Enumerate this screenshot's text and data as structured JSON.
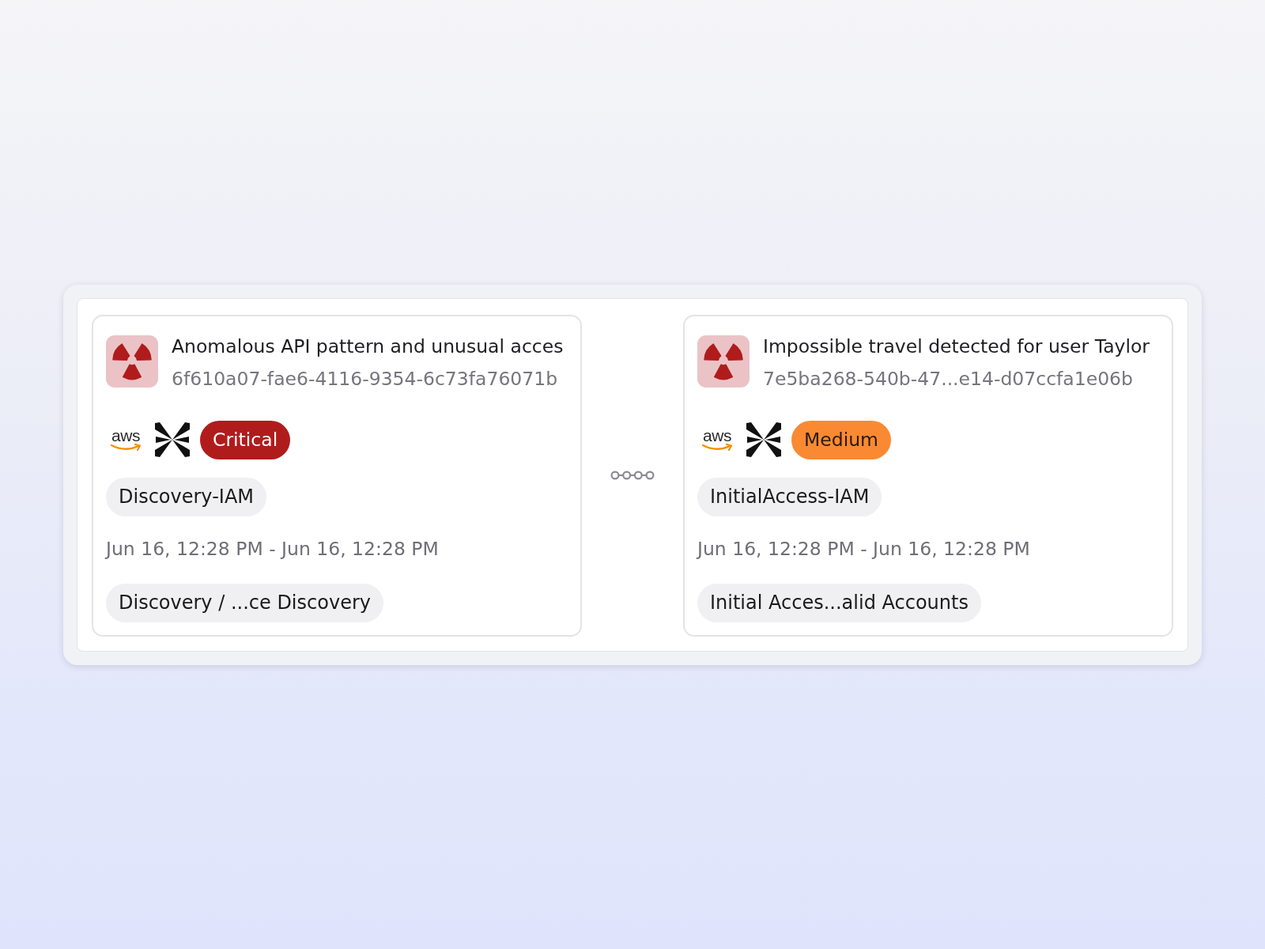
{
  "alerts": [
    {
      "title": "Anomalous API pattern and unusual acces",
      "alert_id": "6f610a07-fae6-4116-9354-6c73fa76071b",
      "provider": "aws",
      "severity": {
        "label": "Critical",
        "color": "#b01c1c"
      },
      "tactic": "Discovery-IAM",
      "time_range": "Jun 16, 12:28 PM - Jun 16, 12:28 PM",
      "technique": "Discovery / ...ce Discovery"
    },
    {
      "title": "Impossible travel detected for user Taylor",
      "alert_id": "7e5ba268-540b-47...e14-d07ccfa1e06b",
      "provider": "aws",
      "severity": {
        "label": "Medium",
        "color": "#f98a33"
      },
      "tactic": "InitialAccess-IAM",
      "time_range": "Jun 16, 12:28 PM - Jun 16, 12:28 PM",
      "technique": "Initial Acces...alid Accounts"
    }
  ]
}
